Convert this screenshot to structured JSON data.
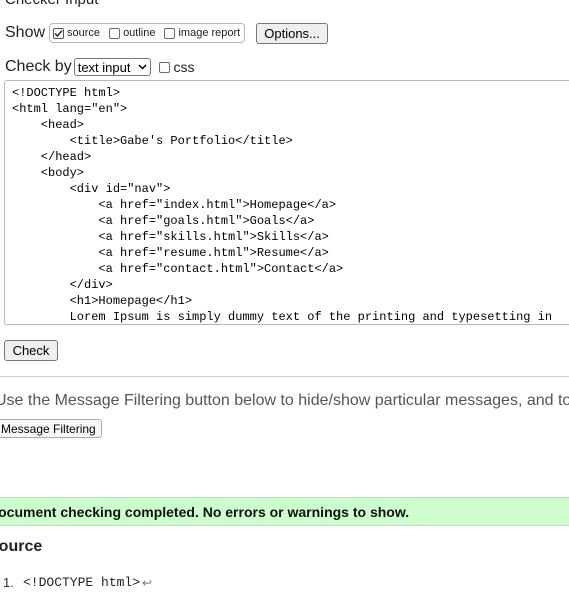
{
  "header": {
    "title": "Checker Input"
  },
  "show": {
    "label": "Show",
    "options": [
      {
        "label": "source",
        "checked": true
      },
      {
        "label": "outline",
        "checked": false
      },
      {
        "label": "image report",
        "checked": false
      }
    ],
    "options_button": "Options..."
  },
  "check_by": {
    "label": "Check by",
    "selected": "text input",
    "css_label": "css",
    "css_checked": false
  },
  "code": {
    "lines": [
      "<!DOCTYPE html>",
      "<html lang=\"en\">",
      "    <head>",
      "        <title>Gabe's Portfolio</title>",
      "    </head>",
      "    <body>",
      "        <div id=\"nav\">",
      "            <a href=\"index.html\">Homepage</a>",
      "            <a href=\"goals.html\">Goals</a>",
      "            <a href=\"skills.html\">Skills</a>",
      "            <a href=\"resume.html\">Resume</a>",
      "            <a href=\"contact.html\">Contact</a>",
      "        </div>",
      "        <h1>Homepage</h1>",
      "        Lorem Ipsum is simply dummy text of the printing and typesetting in"
    ]
  },
  "check_button": "Check",
  "filter": {
    "note": "Use the Message Filtering button below to hide/show particular messages, and to",
    "button": "Message Filtering"
  },
  "result": {
    "message": "Document checking completed. No errors or warnings to show."
  },
  "source": {
    "heading": "Source",
    "lines": [
      {
        "num": "1.",
        "code": "<!DOCTYPE html>",
        "ret": "↩"
      }
    ]
  }
}
